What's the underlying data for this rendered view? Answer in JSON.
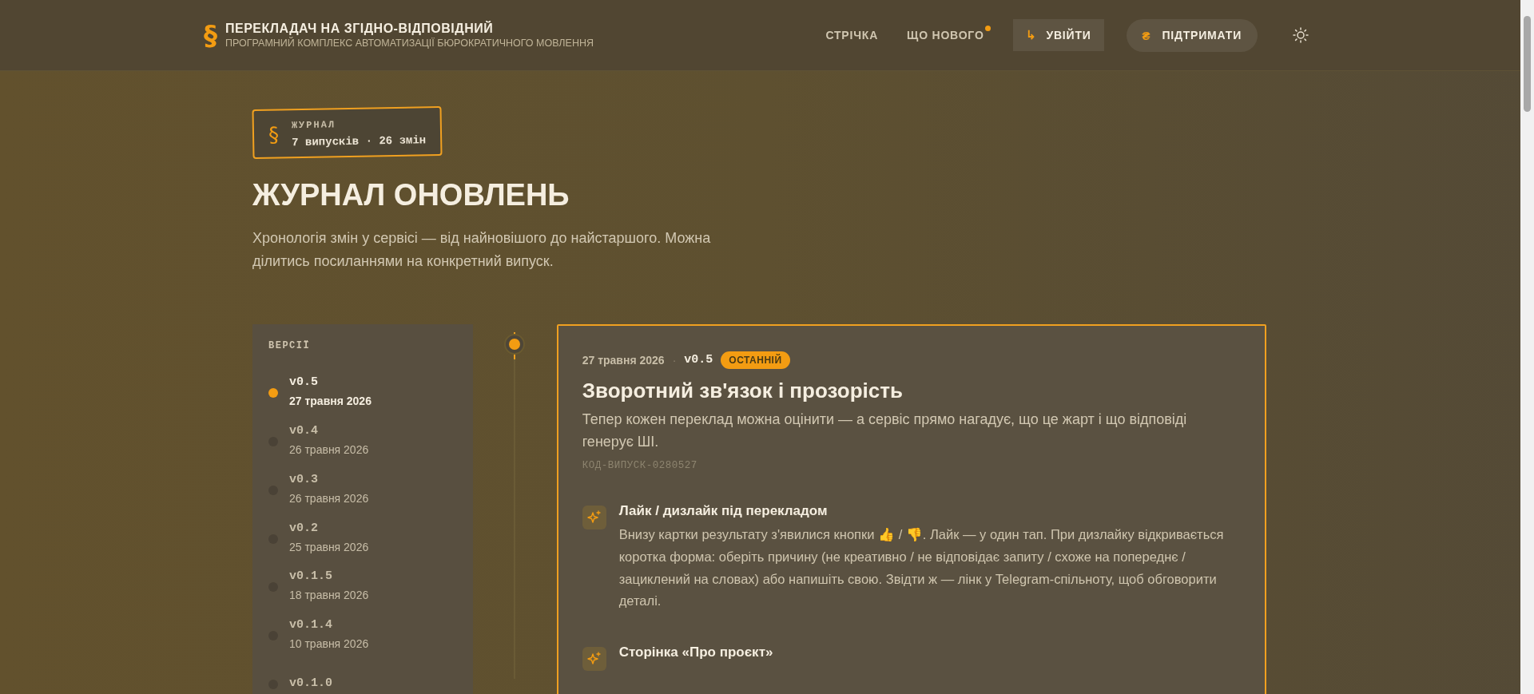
{
  "header": {
    "logo_symbol": "§",
    "title": "ПЕРЕКЛАДАЧ НА ЗГІДНО-ВІДПОВІДНИЙ",
    "subtitle": "ПРОГРАМНИЙ КОМПЛЕКС АВТОМАТИЗАЦІЇ БЮРОКРАТИЧНОГО МОВЛЕННЯ",
    "nav": [
      {
        "label": "СТРІЧКА",
        "has_update": false
      },
      {
        "label": "ЩО НОВОГО",
        "has_update": true
      }
    ],
    "login": {
      "icon": "↳",
      "label": "УВІЙТИ"
    },
    "support": {
      "icon": "₴",
      "label": "ПІДТРИМАТИ"
    }
  },
  "badge": {
    "symbol": "§",
    "label": "ЖУРНАЛ",
    "counts": "7 випусків · 26 змін"
  },
  "page_title": "ЖУРНАЛ ОНОВЛЕНЬ",
  "intro": "Хронологія змін у сервісі — від найновішого до найстаршого. Можна ділитись посиланнями на конкретний випуск.",
  "sidebar": {
    "heading": "ВЕРСІЇ",
    "versions": [
      {
        "version": "v0.5",
        "date": "27 травня 2026",
        "selected": true
      },
      {
        "version": "v0.4",
        "date": "26 травня 2026",
        "selected": false
      },
      {
        "version": "v0.3",
        "date": "26 травня 2026",
        "selected": false
      },
      {
        "version": "v0.2",
        "date": "25 травня 2026",
        "selected": false
      },
      {
        "version": "v0.1.5",
        "date": "18 травня 2026",
        "selected": false
      },
      {
        "version": "v0.1.4",
        "date": "10 травня 2026",
        "selected": false
      },
      {
        "version": "v0.1.0",
        "selected": false
      }
    ]
  },
  "release": {
    "date": "27 травня 2026",
    "separator": "·",
    "version": "v0.5",
    "tag": "ОСТАННІЙ",
    "title": "Зворотний зв'язок і прозорість",
    "description": "Тепер кожен переклад можна оцінити — а сервіс прямо нагадує, що це жарт і що відповіді генерує ШІ.",
    "code": "КОД-ВИПУСК-0280527",
    "changes": [
      {
        "title": "Лайк / дизлайк під перекладом",
        "description": "Внизу картки результату з'явилися кнопки 👍 / 👎. Лайк — у один тап. При дизлайку відкривається коротка форма: оберіть причину (не креативно / не відповідає запиту / схоже на попереднє / зациклений на словах) або напишіть свою. Звідти ж — лінк у Telegram-спільноту, щоб обговорити деталі."
      },
      {
        "title": "Сторінка «Про проєкт»"
      }
    ]
  }
}
